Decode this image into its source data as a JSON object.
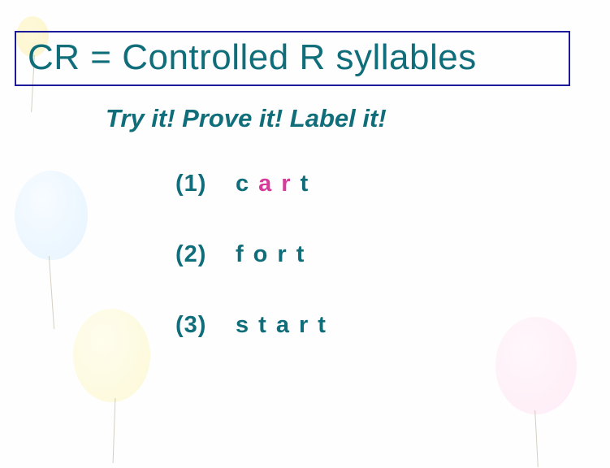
{
  "title": "CR = Controlled R syllables",
  "subtitle": "Try it!  Prove it! Label it!",
  "items": [
    {
      "number": "(1)",
      "letters": [
        {
          "ch": "c",
          "hl": false
        },
        {
          "ch": "a",
          "hl": true
        },
        {
          "ch": "r",
          "hl": true
        },
        {
          "ch": "t",
          "hl": false
        }
      ]
    },
    {
      "number": "(2)",
      "letters": [
        {
          "ch": "f",
          "hl": false
        },
        {
          "ch": "o",
          "hl": false
        },
        {
          "ch": "r",
          "hl": false
        },
        {
          "ch": "t",
          "hl": false
        }
      ]
    },
    {
      "number": "(3)",
      "letters": [
        {
          "ch": "s",
          "hl": false
        },
        {
          "ch": "t",
          "hl": false
        },
        {
          "ch": "a",
          "hl": false
        },
        {
          "ch": "r",
          "hl": false
        },
        {
          "ch": "t",
          "hl": false
        }
      ]
    }
  ],
  "colors": {
    "text": "#0f6e7a",
    "highlight": "#d63b9a",
    "border": "#1a1a9a"
  }
}
